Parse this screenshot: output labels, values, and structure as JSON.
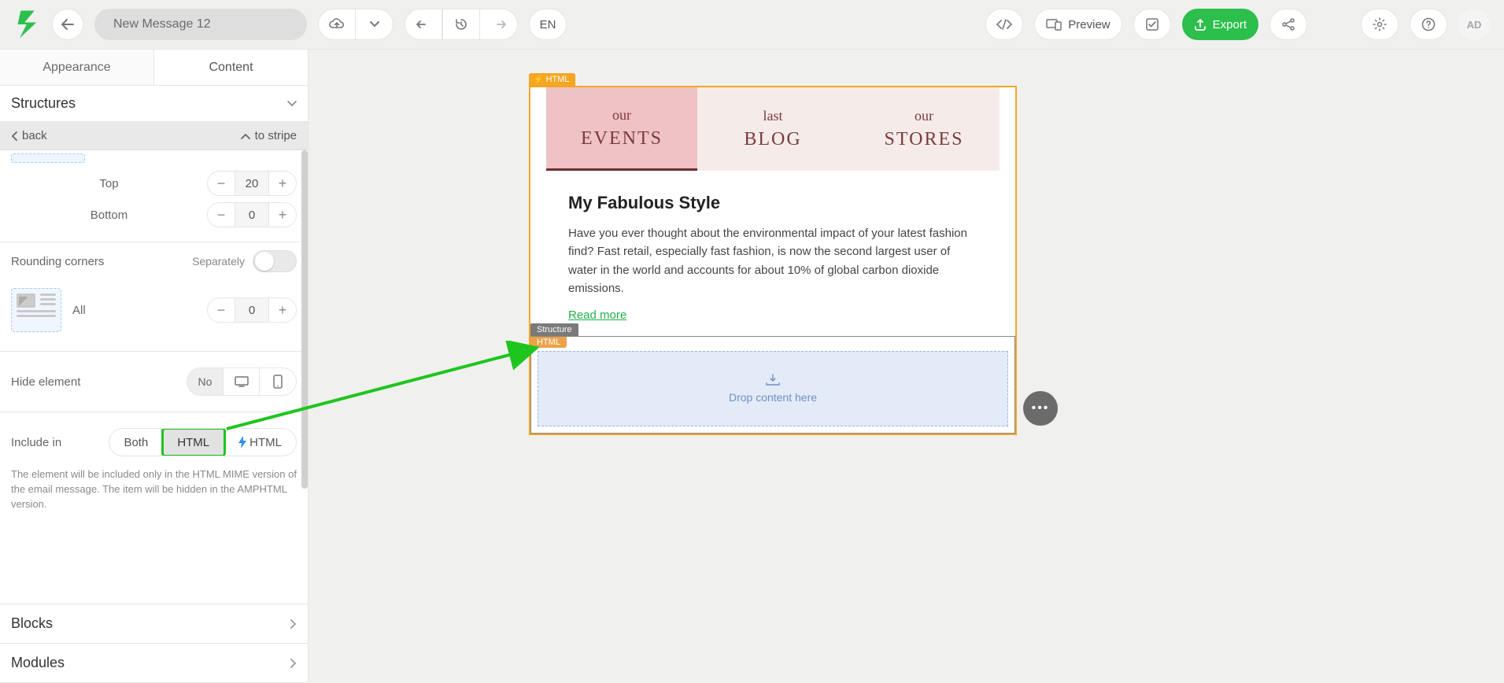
{
  "header": {
    "title": "New Message 12",
    "lang": "EN",
    "preview": "Preview",
    "export": "Export",
    "ad": "AD"
  },
  "sidebar": {
    "tabs": {
      "appearance": "Appearance",
      "content": "Content"
    },
    "structures": "Structures",
    "back": "back",
    "to_stripe": "to stripe",
    "padding": {
      "top_label": "Top",
      "top_value": "20",
      "bottom_label": "Bottom",
      "bottom_value": "0"
    },
    "rounding": {
      "label": "Rounding corners",
      "separately": "Separately",
      "all": "All",
      "value": "0"
    },
    "hide": {
      "label": "Hide element",
      "no": "No"
    },
    "include": {
      "label": "Include in",
      "both": "Both",
      "html": "HTML",
      "amp_html": "HTML"
    },
    "include_help": "The element will be included only in the HTML MIME version of the email message. The item will be hidden in the AMPHTML version.",
    "blocks": "Blocks",
    "modules": "Modules"
  },
  "canvas": {
    "html_badge": "HTML",
    "structure_badge": "Structure",
    "tabs": [
      {
        "small": "our",
        "big": "EVENTS",
        "active": true
      },
      {
        "small": "last",
        "big": "BLOG",
        "active": false
      },
      {
        "small": "our",
        "big": "STORES",
        "active": false
      }
    ],
    "article": {
      "title": "My Fabulous Style",
      "body": "Have you ever thought about the environmental impact of your latest fashion find? Fast retail, especially fast fashion, is now the second largest user of water in the world and accounts for about 10% of global carbon dioxide emissions.",
      "read_more": "Read more"
    },
    "dropzone": "Drop content here"
  }
}
